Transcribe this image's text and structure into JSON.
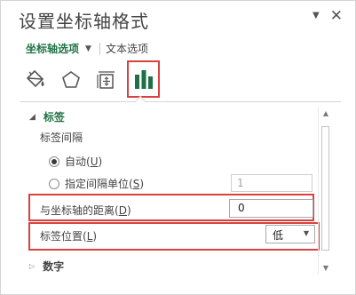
{
  "pane": {
    "title": "设置坐标轴格式",
    "pin_glyph": "▼",
    "close_glyph": "✕"
  },
  "options_row": {
    "axis_options_label": "坐标轴选项",
    "caret_glyph": "▼",
    "text_options_label": "文本选项"
  },
  "icon_tabs": [
    {
      "icon": "paint-bucket-icon",
      "selected": false
    },
    {
      "icon": "pentagon-icon",
      "selected": false
    },
    {
      "icon": "size-properties-icon",
      "selected": false
    },
    {
      "icon": "bar-chart-icon",
      "selected": true
    }
  ],
  "labels_section": {
    "header": "标签",
    "expanded_glyph": "◢",
    "interval_label": "标签间隔",
    "auto_radio": {
      "label": "自动(",
      "key": "U",
      "close": ")",
      "checked": true
    },
    "specify_radio": {
      "label": "指定间隔单位(",
      "key": "S",
      "close": ")",
      "checked": false
    },
    "specify_value": "1",
    "distance": {
      "label": "与坐标轴的距离(",
      "key": "D",
      "close": ")",
      "value": "0"
    },
    "position": {
      "label": "标签位置(",
      "key": "L",
      "close": ")",
      "value": "低",
      "caret_glyph": "▼"
    }
  },
  "number_section": {
    "header": "数字",
    "collapsed_glyph": "▷"
  },
  "scrollbar": {
    "up_glyph": "▲",
    "down_glyph": "▼"
  },
  "colors": {
    "accent_green": "#217346",
    "highlight_red": "#d9413e",
    "chart_icon_green": "#1e7145"
  }
}
